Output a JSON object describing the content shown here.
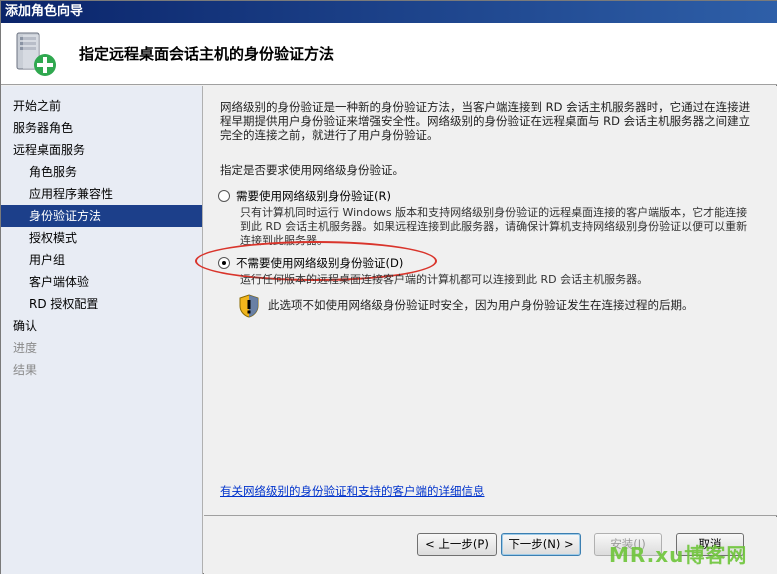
{
  "window": {
    "title": "添加角色向导"
  },
  "header": {
    "title": "指定远程桌面会话主机的身份验证方法",
    "icon": "server-add-icon"
  },
  "sidebar": {
    "items": [
      {
        "label": "开始之前",
        "level": 0,
        "state": "normal"
      },
      {
        "label": "服务器角色",
        "level": 0,
        "state": "normal"
      },
      {
        "label": "远程桌面服务",
        "level": 0,
        "state": "normal"
      },
      {
        "label": "角色服务",
        "level": 1,
        "state": "normal"
      },
      {
        "label": "应用程序兼容性",
        "level": 1,
        "state": "normal"
      },
      {
        "label": "身份验证方法",
        "level": 1,
        "state": "active"
      },
      {
        "label": "授权模式",
        "level": 1,
        "state": "normal"
      },
      {
        "label": "用户组",
        "level": 1,
        "state": "normal"
      },
      {
        "label": "客户端体验",
        "level": 1,
        "state": "normal"
      },
      {
        "label": "RD 授权配置",
        "level": 1,
        "state": "normal"
      },
      {
        "label": "确认",
        "level": 0,
        "state": "normal"
      },
      {
        "label": "进度",
        "level": 0,
        "state": "disabled"
      },
      {
        "label": "结果",
        "level": 0,
        "state": "disabled"
      }
    ]
  },
  "content": {
    "intro": "网络级别的身份验证是一种新的身份验证方法，当客户端连接到 RD 会话主机服务器时，它通过在连接进程早期提供用户身份验证来增强安全性。网络级别的身份验证在远程桌面与 RD 会话主机服务器之间建立完全的连接之前，就进行了用户身份验证。",
    "question": "指定是否要求使用网络级身份验证。",
    "option_require": {
      "label": "需要使用网络级别身份验证(R)",
      "desc": "只有计算机同时运行 Windows 版本和支持网络级别身份验证的远程桌面连接的客户端版本，它才能连接到此 RD 会话主机服务器。如果远程连接到此服务器，请确保计算机支持网络级别身份验证以便可以重新连接到此服务器。",
      "checked": false
    },
    "option_norequire": {
      "label": "不需要使用网络级别身份验证(D)",
      "desc": "运行任何版本的远程桌面连接客户端的计算机都可以连接到此 RD 会话主机服务器。",
      "checked": true
    },
    "warning": {
      "icon": "shield-warning-icon",
      "text": "此选项不如使用网络级身份验证时安全，因为用户身份验证发生在连接过程的后期。"
    },
    "link": "有关网络级别的身份验证和支持的客户端的详细信息"
  },
  "buttons": {
    "prev": "< 上一步(P)",
    "next": "下一步(N) >",
    "install": "安装(I)",
    "cancel": "取消"
  },
  "watermark": "MR.xu博客网",
  "colors": {
    "active_item": "#1c3f8a",
    "annotation": "#d9342b",
    "link": "#0033cc"
  }
}
